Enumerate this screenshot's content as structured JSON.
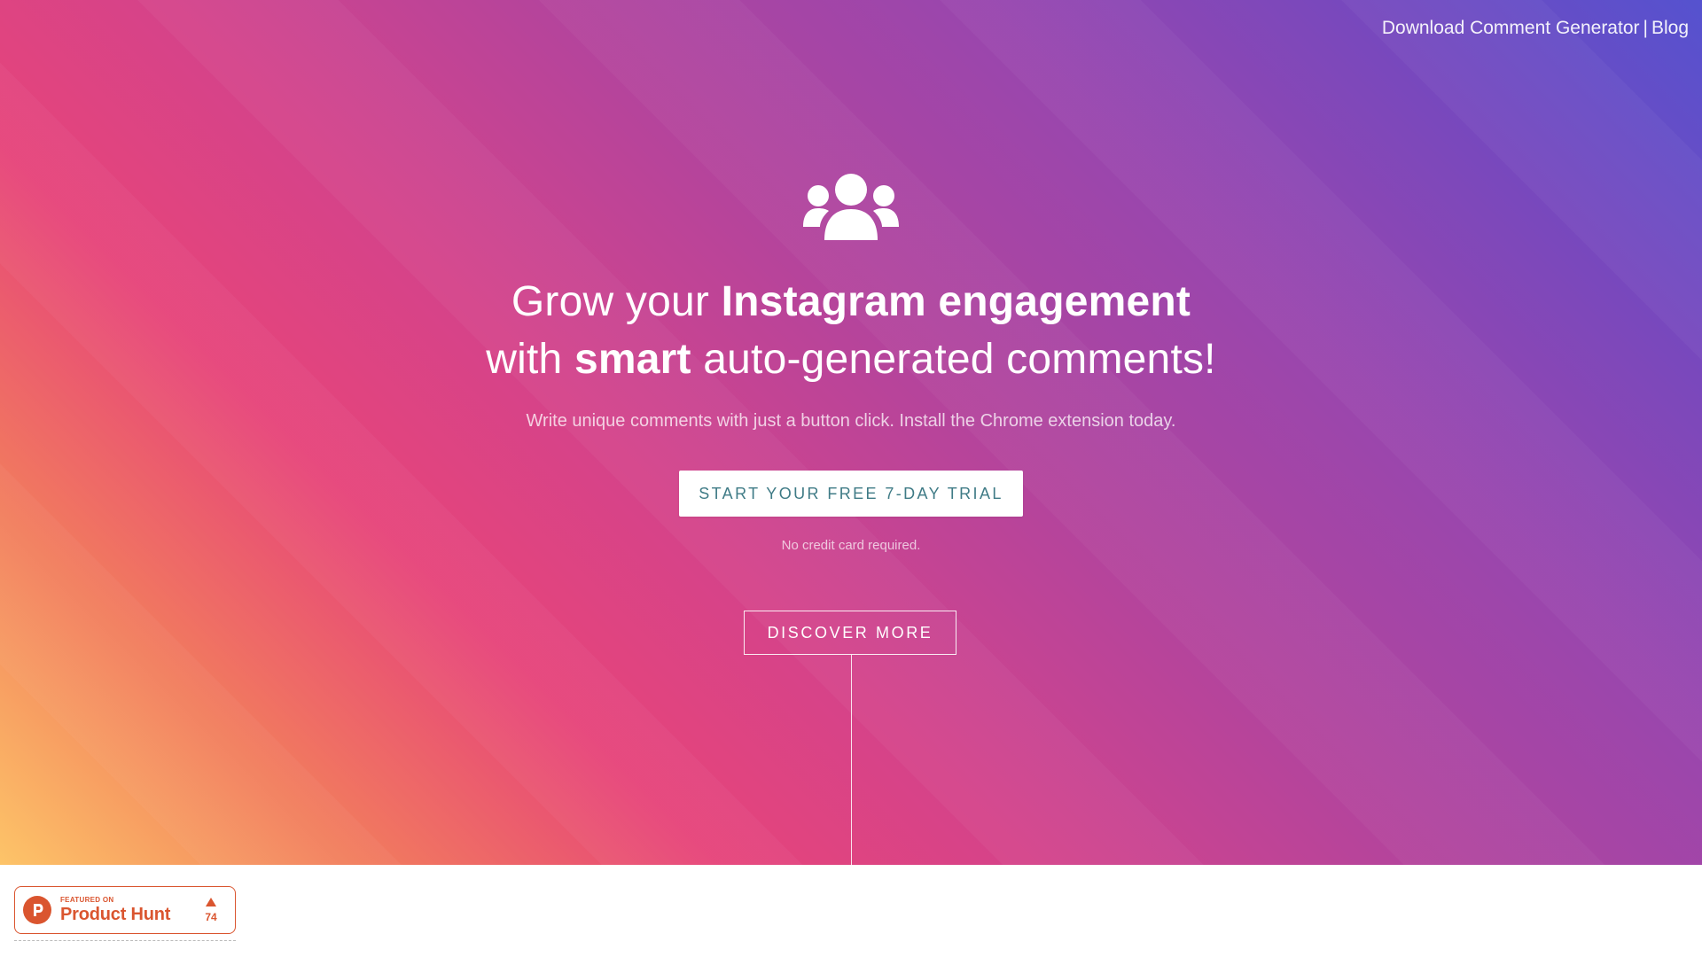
{
  "nav": {
    "download_link": "Download Comment Generator",
    "separator": "|",
    "blog_link": "Blog"
  },
  "hero": {
    "icon": "users-icon",
    "headline": {
      "line1_light": "Grow your ",
      "line1_bold": "Instagram engagement",
      "line2_light_a": "with ",
      "line2_bold": "smart",
      "line2_light_b": " auto-generated comments!"
    },
    "subtitle": "Write unique comments with just a button click. Install the Chrome extension today.",
    "trial_button": "START YOUR FREE 7-DAY TRIAL",
    "no_credit_card": "No credit card required.",
    "discover_button": "DISCOVER MORE"
  },
  "product_hunt_badge": {
    "featured_on": "FEATURED ON",
    "name": "Product Hunt",
    "upvotes": "74",
    "logo_letter": "P",
    "icon": "product-hunt-logo-icon",
    "accent_color": "#da552f"
  },
  "colors": {
    "gradient_start": "#fdc468",
    "gradient_mid": "#e6447a",
    "gradient_end": "#5552cf",
    "trial_button_text": "#3f7b86"
  }
}
